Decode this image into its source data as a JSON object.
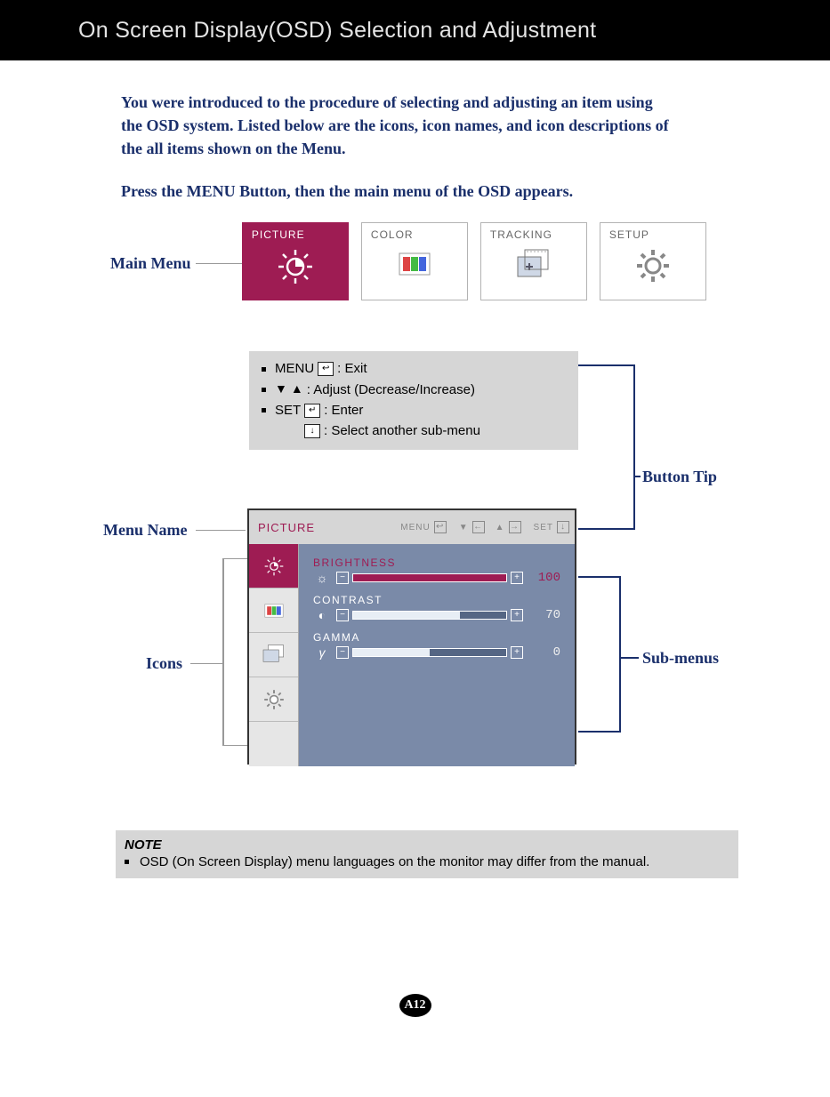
{
  "header": {
    "title": "On Screen Display(OSD) Selection and Adjustment"
  },
  "intro": {
    "p1": "You were introduced to the procedure of selecting and adjusting an item using the OSD system.  Listed below are the icons, icon names, and icon descriptions of the all items shown on the Menu.",
    "p2": "Press the MENU Button, then the main menu of the OSD appears."
  },
  "callouts": {
    "main_menu": "Main Menu",
    "button_tip": "Button Tip",
    "menu_name": "Menu Name",
    "icons": "Icons",
    "sub_menus": "Sub-menus"
  },
  "tabs": [
    {
      "label": "PICTURE",
      "active": true,
      "icon": "brightness"
    },
    {
      "label": "COLOR",
      "active": false,
      "icon": "color"
    },
    {
      "label": "TRACKING",
      "active": false,
      "icon": "tracking"
    },
    {
      "label": "SETUP",
      "active": false,
      "icon": "setup"
    }
  ],
  "button_tip": {
    "menu_label": "MENU",
    "menu_desc": ": Exit",
    "adjust_desc": ": Adjust (Decrease/Increase)",
    "set_label": "SET",
    "set_desc": ": Enter",
    "select_desc": ": Select another sub-menu"
  },
  "osd": {
    "title": "PICTURE",
    "nav_menu": "MENU",
    "nav_set": "SET",
    "side_icons": [
      "brightness",
      "color",
      "tracking",
      "setup"
    ],
    "submenus": [
      {
        "label": "BRIGHTNESS",
        "value": 100,
        "selected": true,
        "icon": "☼"
      },
      {
        "label": "CONTRAST",
        "value": 70,
        "selected": false,
        "icon": "◐"
      },
      {
        "label": "GAMMA",
        "value": 0,
        "selected": false,
        "icon": "γ"
      }
    ]
  },
  "note": {
    "title": "NOTE",
    "body": "OSD (On Screen Display) menu languages on the monitor may differ from the manual."
  },
  "page_number": "A12"
}
